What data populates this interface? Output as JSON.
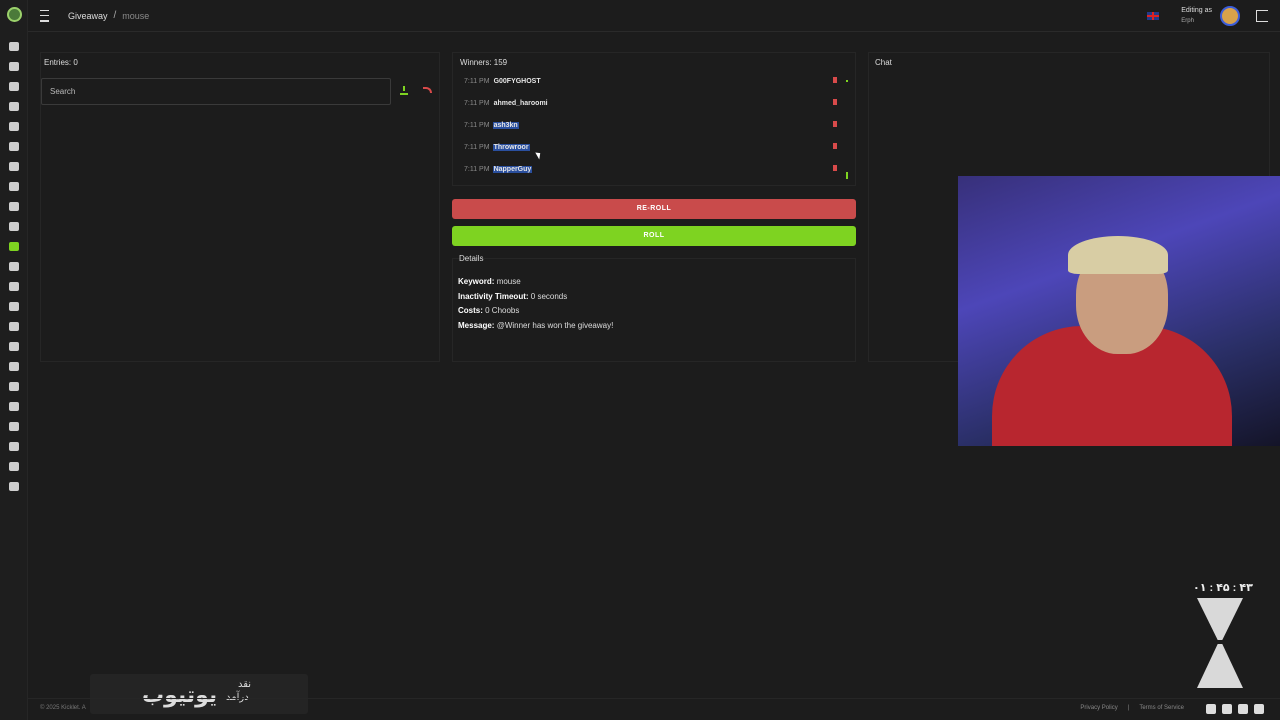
{
  "breadcrumb": {
    "root": "Giveaway",
    "separator": "/",
    "current": "mouse"
  },
  "header": {
    "editing_label": "Editing as",
    "editing_user": "Erph"
  },
  "entries": {
    "title": "Entries: 0",
    "search_placeholder": "Search"
  },
  "winners": {
    "title": "Winners: 159",
    "rows": [
      {
        "time": "7:11 PM",
        "name": "G00FYGHOST"
      },
      {
        "time": "7:11 PM",
        "name": "ahmed_haroomi"
      },
      {
        "time": "7:11 PM",
        "name": "ash3kn"
      },
      {
        "time": "7:11 PM",
        "name": "Throwroor"
      },
      {
        "time": "7:11 PM",
        "name": "NapperGuy"
      }
    ]
  },
  "buttons": {
    "reroll": "RE-ROLL",
    "roll": "ROLL"
  },
  "details": {
    "title": "Details",
    "keyword_label": "Keyword:",
    "keyword": "mouse",
    "inactivity_label": "Inactivity Timeout:",
    "inactivity": "0 seconds",
    "costs_label": "Costs:",
    "costs": "0 Choobs",
    "message_label": "Message:",
    "message": "@Winner has won the giveaway!"
  },
  "chat": {
    "title": "Chat"
  },
  "overlay": {
    "timer": "۰۱ : ۴۵ : ۴۳",
    "big": "یوتیوب",
    "small1": "نقد",
    "small2": "درآمد"
  },
  "footer": {
    "copyright": "© 2025 Kicklet. A",
    "privacy": "Privacy Policy",
    "sep": "|",
    "terms": "Terms of Service"
  },
  "colors": {
    "accent_green": "#7ed321",
    "danger_red": "#c94b4b",
    "highlight_blue": "#2a4f9e"
  }
}
